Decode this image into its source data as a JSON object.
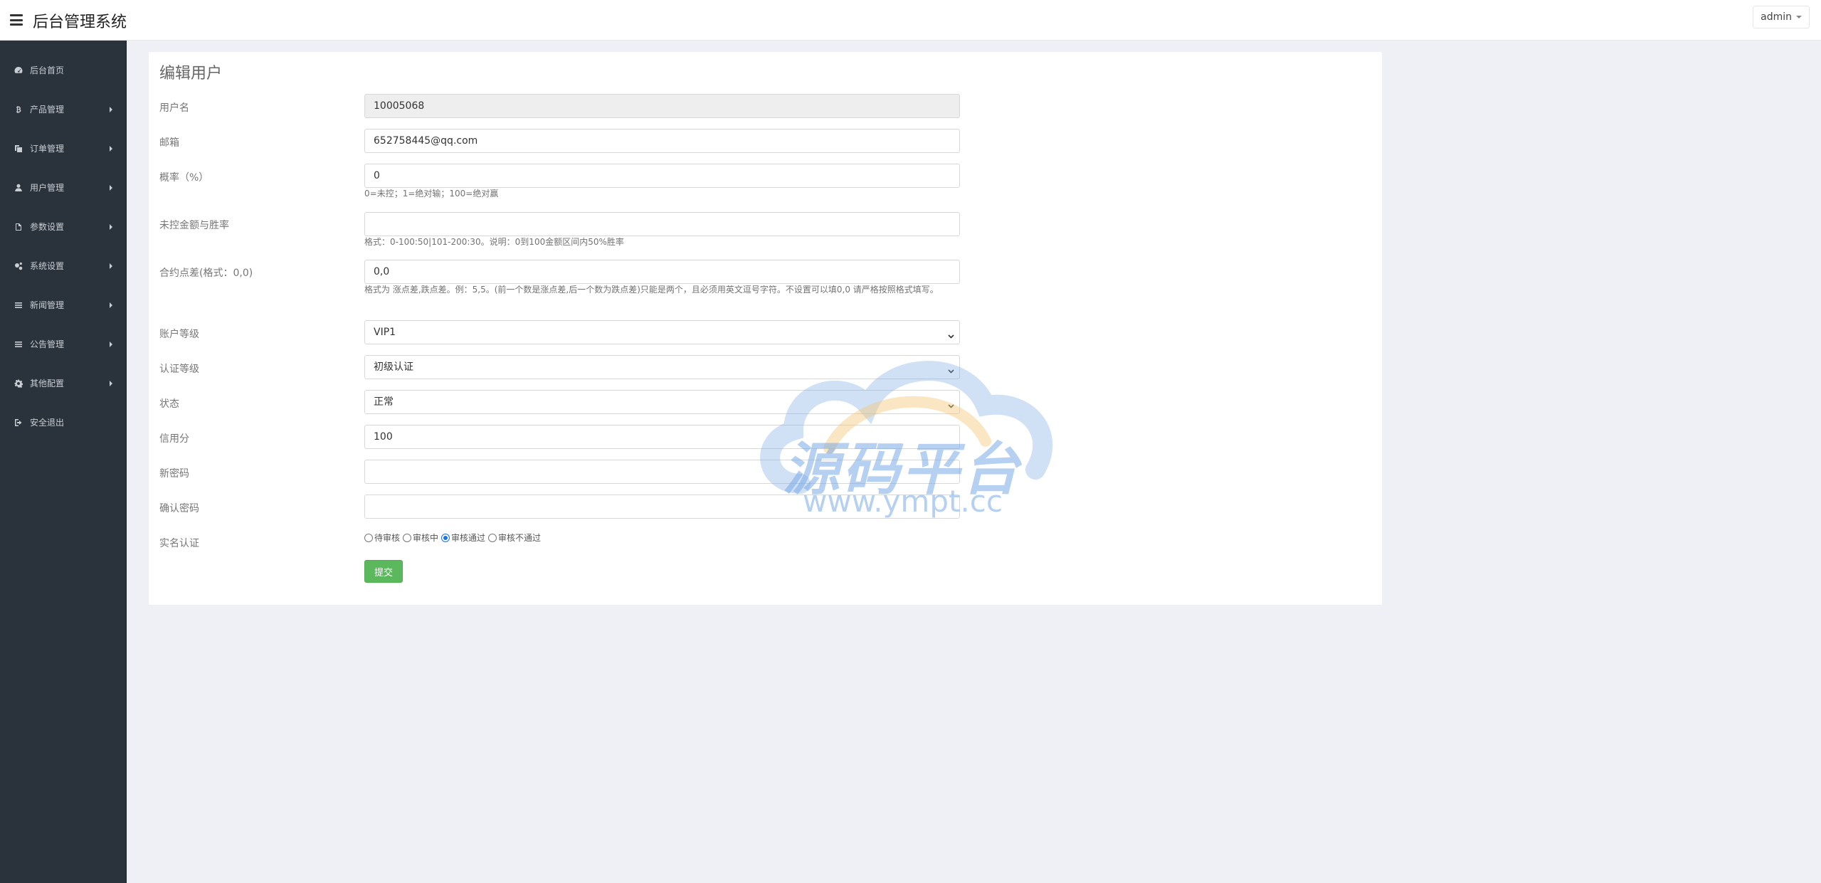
{
  "header": {
    "title": "后台管理系统",
    "user": "admin"
  },
  "sidebar": {
    "items": [
      {
        "label": "后台首页",
        "icon": "dashboard-icon",
        "arrow": false
      },
      {
        "label": "产品管理",
        "icon": "bitcoin-icon",
        "arrow": true
      },
      {
        "label": "订单管理",
        "icon": "copy-icon",
        "arrow": true
      },
      {
        "label": "用户管理",
        "icon": "user-icon",
        "arrow": true
      },
      {
        "label": "参数设置",
        "icon": "file-icon",
        "arrow": true
      },
      {
        "label": "系统设置",
        "icon": "gears-icon",
        "arrow": true
      },
      {
        "label": "新闻管理",
        "icon": "list-icon",
        "arrow": true
      },
      {
        "label": "公告管理",
        "icon": "list-icon",
        "arrow": true
      },
      {
        "label": "其他配置",
        "icon": "gear-icon",
        "arrow": true
      },
      {
        "label": "安全退出",
        "icon": "sign-out-icon",
        "arrow": false
      }
    ]
  },
  "form": {
    "title": "编辑用户",
    "username": {
      "label": "用户名",
      "value": "10005068"
    },
    "email": {
      "label": "邮箱",
      "value": "652758445@qq.com"
    },
    "rate": {
      "label": "概率（%）",
      "value": "0",
      "help": "0=未控；1=绝对输；100=绝对赢"
    },
    "uncontrolled": {
      "label": "未控金额与胜率",
      "value": "",
      "help": "格式：0-100:50|101-200:30。说明：0到100金额区间内50%胜率"
    },
    "spread": {
      "label": "合约点差(格式：0,0)",
      "value": "0,0",
      "help": "格式为 涨点差,跌点差。例：5,5。(前一个数是涨点差,后一个数为跌点差)只能是两个，且必须用英文逗号字符。不设置可以填0,0 请严格按照格式填写。"
    },
    "account_level": {
      "label": "账户等级",
      "value": "VIP1"
    },
    "auth_level": {
      "label": "认证等级",
      "value": "初级认证"
    },
    "status": {
      "label": "状态",
      "value": "正常"
    },
    "credit": {
      "label": "信用分",
      "value": "100"
    },
    "new_password": {
      "label": "新密码",
      "value": ""
    },
    "confirm_password": {
      "label": "确认密码",
      "value": ""
    },
    "realname": {
      "label": "实名认证",
      "options": [
        "待审核",
        "审核中",
        "审核通过",
        "审核不通过"
      ],
      "selected": "审核通过"
    },
    "submit_label": "提交"
  },
  "watermark": {
    "text": "源码平台",
    "url": "www.ympt.cc"
  },
  "colors": {
    "sidebar": "#2a323b",
    "submit": "#5cb85c",
    "background": "#eff0f5"
  }
}
